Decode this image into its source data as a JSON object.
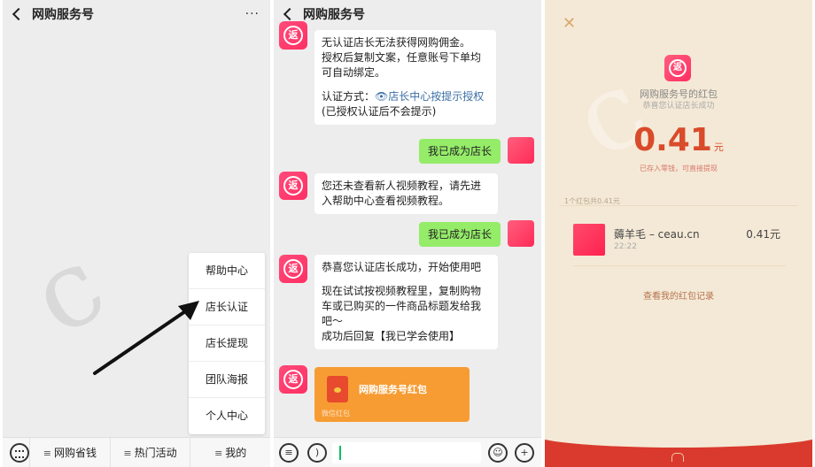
{
  "panel1": {
    "title": "网购服务号",
    "more": "···",
    "popup_items": [
      "帮助中心",
      "店长认证",
      "店长提现",
      "团队海报",
      "个人中心"
    ],
    "menu_tabs": [
      {
        "label": "网购省钱"
      },
      {
        "label": "热门活动"
      },
      {
        "label": "我的"
      }
    ]
  },
  "panel2": {
    "title": "网购服务号",
    "messages": {
      "m1_line1": "无认证店长无法获得网购佣金。",
      "m1_line2": "授权后复制文案，任意账号下单均",
      "m1_line3": "可自动绑定。",
      "m1_line4_prefix": "认证方式：",
      "m1_link": "👁店长中心按提示授权",
      "m1_line5": "(已授权认证后不会提示)",
      "me1": "我已成为店长",
      "m2_line1": "您还未查看新人视频教程，请先进",
      "m2_line2": "入帮助中心查看视频教程。",
      "me2": "我已成为店长",
      "m3_line1": "恭喜您认证店长成功，开始使用吧",
      "m3_line2": "现在试试按视频教程里，复制购物",
      "m3_line3": "车或已购买的一件商品标题发给我",
      "m3_line4": "吧～",
      "m3_line5": "成功后回复【我已学会使用】"
    },
    "redpacket": {
      "title": "网购服务号红包",
      "sub": "微信红包"
    }
  },
  "panel3": {
    "sender": "网购服务号的红包",
    "greeting": "恭喜您认证店长成功",
    "amount": "0.41",
    "unit": "元",
    "stored": "已存入零钱，可直接提现",
    "count": "1个红包共0.41元",
    "record": {
      "name": "薅羊毛 – ceau.cn",
      "time": "22:22",
      "amount": "0.41元"
    },
    "view_link": "查看我的红包记录"
  },
  "colors": {
    "wechat_green": "#95ec69",
    "red_amount": "#d94b2b",
    "packet_orange": "#f79c33",
    "detail_bg": "#f4e9d6"
  }
}
